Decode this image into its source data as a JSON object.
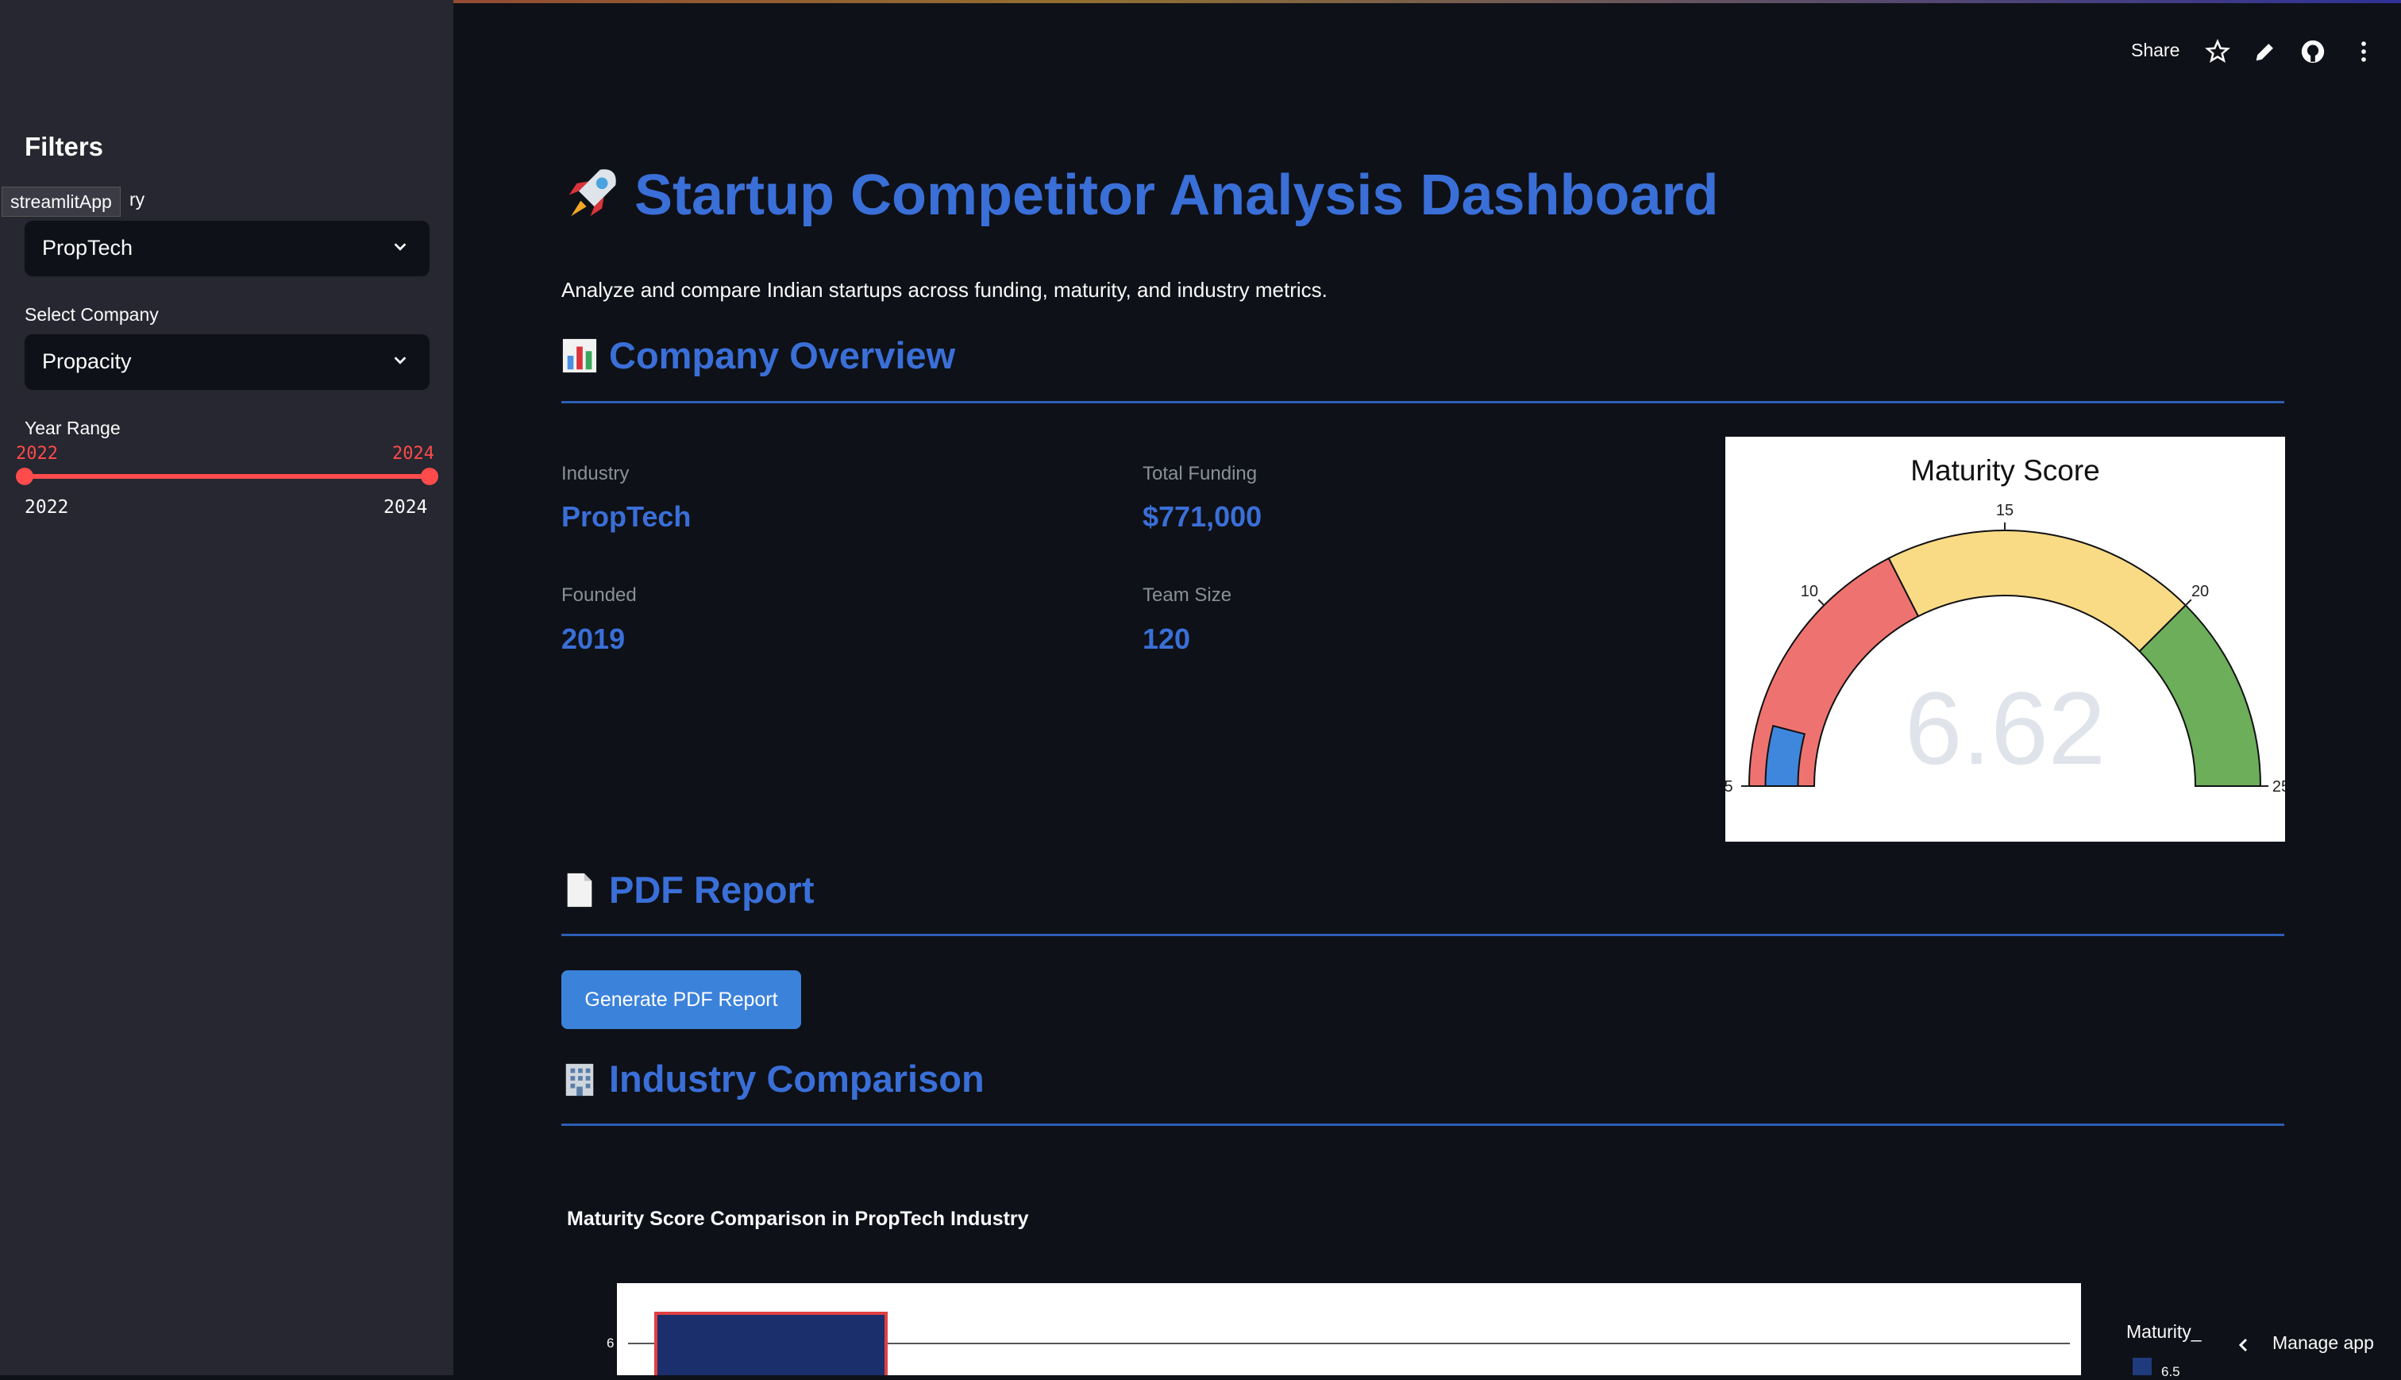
{
  "sidebar": {
    "title": "Filters",
    "tooltip": "streamlitApp",
    "industry_label_visible": "ry",
    "industry_value": "PropTech",
    "company_label": "Select Company",
    "company_value": "Propacity",
    "year_label": "Year Range",
    "year_min_value": "2022",
    "year_max_value": "2024",
    "year_min_tick": "2022",
    "year_max_tick": "2024"
  },
  "header": {
    "share_label": "Share"
  },
  "main": {
    "title": "Startup Competitor Analysis Dashboard",
    "subtitle": "Analyze and compare Indian startups across funding, maturity, and industry metrics.",
    "overview_heading": "Company Overview",
    "metrics": {
      "industry_label": "Industry",
      "industry_value": "PropTech",
      "funding_label": "Total Funding",
      "funding_value": "$771,000",
      "founded_label": "Founded",
      "founded_value": "2019",
      "team_label": "Team Size",
      "team_value": "120"
    },
    "gauge": {
      "title": "Maturity Score",
      "value": "6.62",
      "value_num": 6.62,
      "range": [
        5,
        25
      ],
      "ticks": [
        "5",
        "10",
        "15",
        "20",
        "25"
      ],
      "colors": {
        "low": "#ee7370",
        "mid": "#f9db86",
        "high": "#6cae5a",
        "bar": "#3f86dd"
      }
    },
    "pdf_heading": "PDF Report",
    "pdf_button": "Generate PDF Report",
    "industry_heading": "Industry Comparison",
    "chart_title": "Maturity Score Comparison in PropTech Industry",
    "chart_ytick": "6",
    "legend_title": "Maturity_",
    "legend_item": "6.5"
  },
  "footer": {
    "manage_label": "Manage app"
  },
  "colors": {
    "accent": "#3a6fd8",
    "slider": "#ff4b4b",
    "bg": "#0e1117",
    "sidebar": "#262730"
  }
}
